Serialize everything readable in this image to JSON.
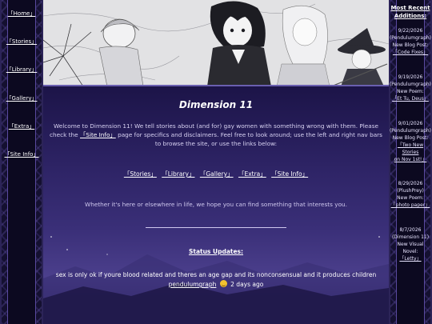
{
  "left_nav": {
    "items": [
      {
        "label": "「Home」"
      },
      {
        "label": "「Stories」"
      },
      {
        "label": "「Library」"
      },
      {
        "label": "「Gallery」"
      },
      {
        "label": "「Extra」"
      },
      {
        "label": "「Site Info」"
      }
    ]
  },
  "recent": {
    "title_line1": "Most Recent",
    "title_line2": "Additions:",
    "entries": [
      {
        "date": "9/22/2026",
        "author": "(Pendulumgraph)",
        "type_line1": "New Blog Post:",
        "type_line2": "",
        "link_line1": "「Code Fixes」",
        "link_line2": "",
        "link_line3": ""
      },
      {
        "date": "9/19/2026",
        "author": "(Pendulumgraph)",
        "type_line1": "New Poem:",
        "type_line2": "",
        "link_line1": "「Et Tu, Deus」",
        "link_line2": "",
        "link_line3": ""
      },
      {
        "date": "9/01/2026",
        "author": "(Pendulumgraph)",
        "type_line1": "New Blog Post:",
        "type_line2": "",
        "link_line1": "「Two New",
        "link_line2": "Stories",
        "link_line3": "on Nov 1st!」"
      },
      {
        "date": "8/29/2026",
        "author": "(PlushPrey)",
        "type_line1": "New Poem:",
        "type_line2": "",
        "link_line1": "「photo paper」",
        "link_line2": "",
        "link_line3": ""
      },
      {
        "date": "8/7/2026",
        "author": "(Dimension 11)",
        "type_line1": "New Visual",
        "type_line2": "Novel:",
        "link_line1": "「Letty」",
        "link_line2": "",
        "link_line3": ""
      }
    ]
  },
  "main": {
    "title": "Dimension 11",
    "intro_part1": "Welcome to Dimension 11! We tell stories about (and for) gay women with something wrong with them. Please check the",
    "intro_link": "「Site Info」",
    "intro_part2": "page for specifics and disclaimers. Feel free to look around; use the left and right nav bars to browse the site, or use the links below:",
    "links": [
      "「Stories」",
      "「Library」",
      "「Gallery」",
      "「Extra」",
      "「Site Info」"
    ],
    "tagline": "Whether it's here or elsewhere in life, we hope you can find something that interests you.",
    "status_heading": "Status Updates:",
    "status_text": "sex is only ok if youre blood related and theres an age gap and its nonconsensual and it produces children",
    "status_author": "pendulumgraph",
    "status_time": "2 days ago"
  },
  "colors": {
    "accent": "#6a5fb0",
    "link": "#ffffff",
    "background": "#2e2466"
  },
  "icons": {
    "status_emoji": "smiling-face-icon"
  }
}
